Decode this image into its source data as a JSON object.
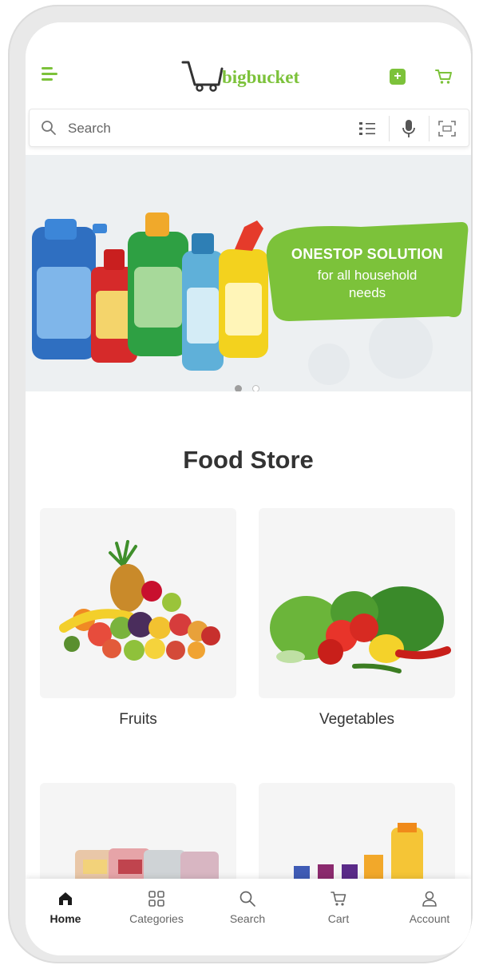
{
  "header": {
    "logo_text": "bigbucket",
    "brand_color": "#7cc23a"
  },
  "search": {
    "placeholder": "Search"
  },
  "banner": {
    "title": "ONESTOP SOLUTION",
    "subtitle_line1": "for all household",
    "subtitle_line2": "needs",
    "slide_count": 2,
    "active_slide": 1
  },
  "section": {
    "title": "Food Store"
  },
  "categories": [
    {
      "label": "Fruits"
    },
    {
      "label": "Vegetables"
    },
    {
      "label": ""
    },
    {
      "label": ""
    }
  ],
  "bottom_nav": {
    "items": [
      {
        "label": "Home",
        "icon": "home-icon",
        "active": true
      },
      {
        "label": "Categories",
        "icon": "categories-icon",
        "active": false
      },
      {
        "label": "Search",
        "icon": "search-icon",
        "active": false
      },
      {
        "label": "Cart",
        "icon": "cart-icon",
        "active": false
      },
      {
        "label": "Account",
        "icon": "account-icon",
        "active": false
      }
    ]
  }
}
